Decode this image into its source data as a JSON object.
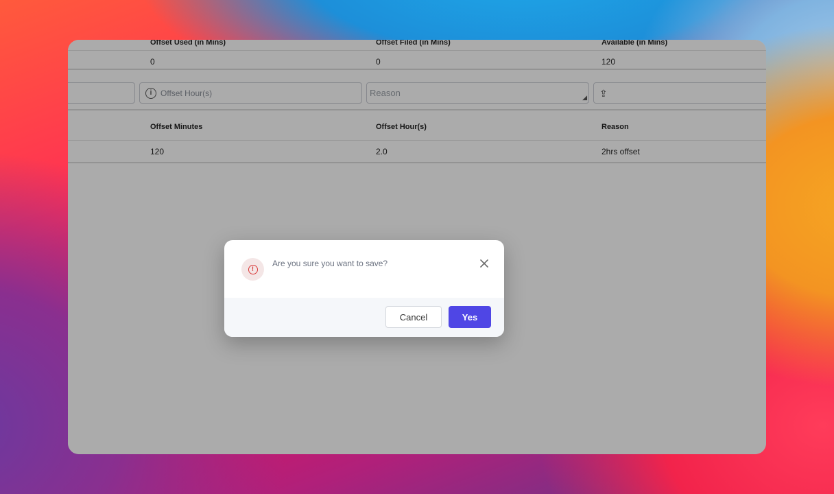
{
  "summary": {
    "headers": [
      "Offset Used (in Mins)",
      "Offset Filed (in Mins)",
      "Available (in Mins)"
    ],
    "values": [
      "0",
      "0",
      "120"
    ]
  },
  "form": {
    "hours_placeholder": "Offset Hour(s)",
    "reason_placeholder": "Reason"
  },
  "table": {
    "headers": [
      "Offset Minutes",
      "Offset Hour(s)",
      "Reason"
    ],
    "rows": [
      [
        "120",
        "2.0",
        "2hrs offset"
      ]
    ]
  },
  "dialog": {
    "message": "Are you sure you want to save?",
    "cancel_label": "Cancel",
    "yes_label": "Yes",
    "accent_color": "#4f46e5",
    "warning_color": "#d93a3a"
  }
}
